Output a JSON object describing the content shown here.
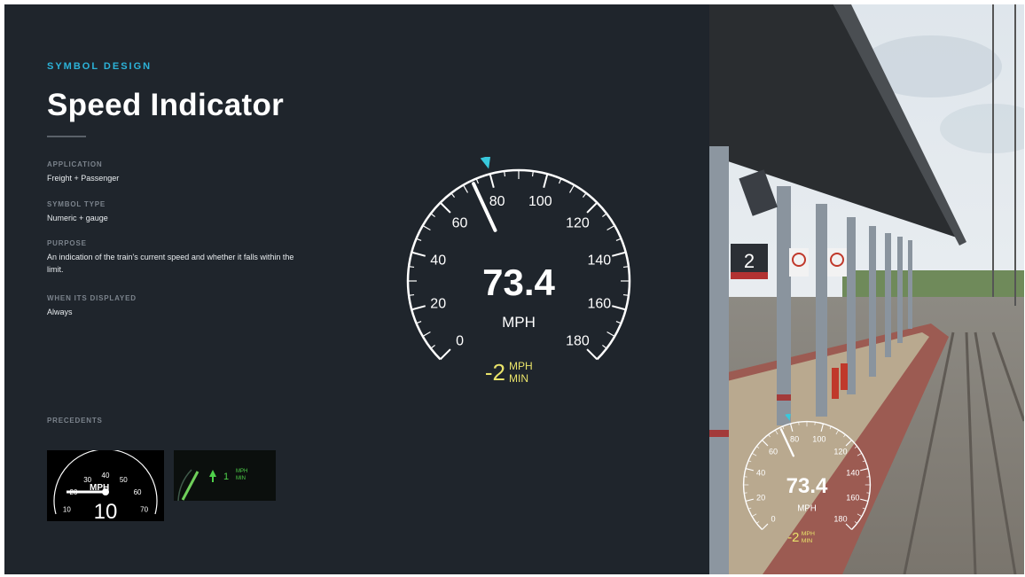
{
  "header": {
    "eyebrow": "SYMBOL DESIGN",
    "title": "Speed Indicator"
  },
  "meta": [
    {
      "label": "APPLICATION",
      "value": "Freight + Passenger"
    },
    {
      "label": "SYMBOL TYPE",
      "value": "Numeric + gauge"
    },
    {
      "label": "PURPOSE",
      "value": "An indication of the train's current speed and whether it falls within the limit."
    },
    {
      "label": "WHEN ITS DISPLAYED",
      "value": "Always"
    }
  ],
  "precedents": {
    "label": "PRECEDENTS",
    "analog": {
      "unit": "MPH",
      "speed": "10",
      "ticks": [
        "0",
        "10",
        "20",
        "30",
        "40",
        "50",
        "60",
        "70",
        "80"
      ]
    },
    "digital": {
      "value": "1",
      "unit_top": "MPH",
      "unit_bottom": "MIN"
    }
  },
  "gauge": {
    "speed_value": 73.4,
    "speed_text": "73.4",
    "unit": "MPH",
    "max": 180,
    "limit_marker": 80,
    "ticks": [
      "0",
      "20",
      "40",
      "60",
      "80",
      "100",
      "120",
      "140",
      "160",
      "180"
    ],
    "accel_text": "-2",
    "accel_unit_top": "MPH",
    "accel_unit_bottom": "MIN",
    "colors": {
      "needle": "#ffffff",
      "marker": "#38c8dc",
      "accel": "#e9e36a",
      "arc": "#ffffff"
    }
  },
  "photo": {
    "platform_sign": "2"
  }
}
